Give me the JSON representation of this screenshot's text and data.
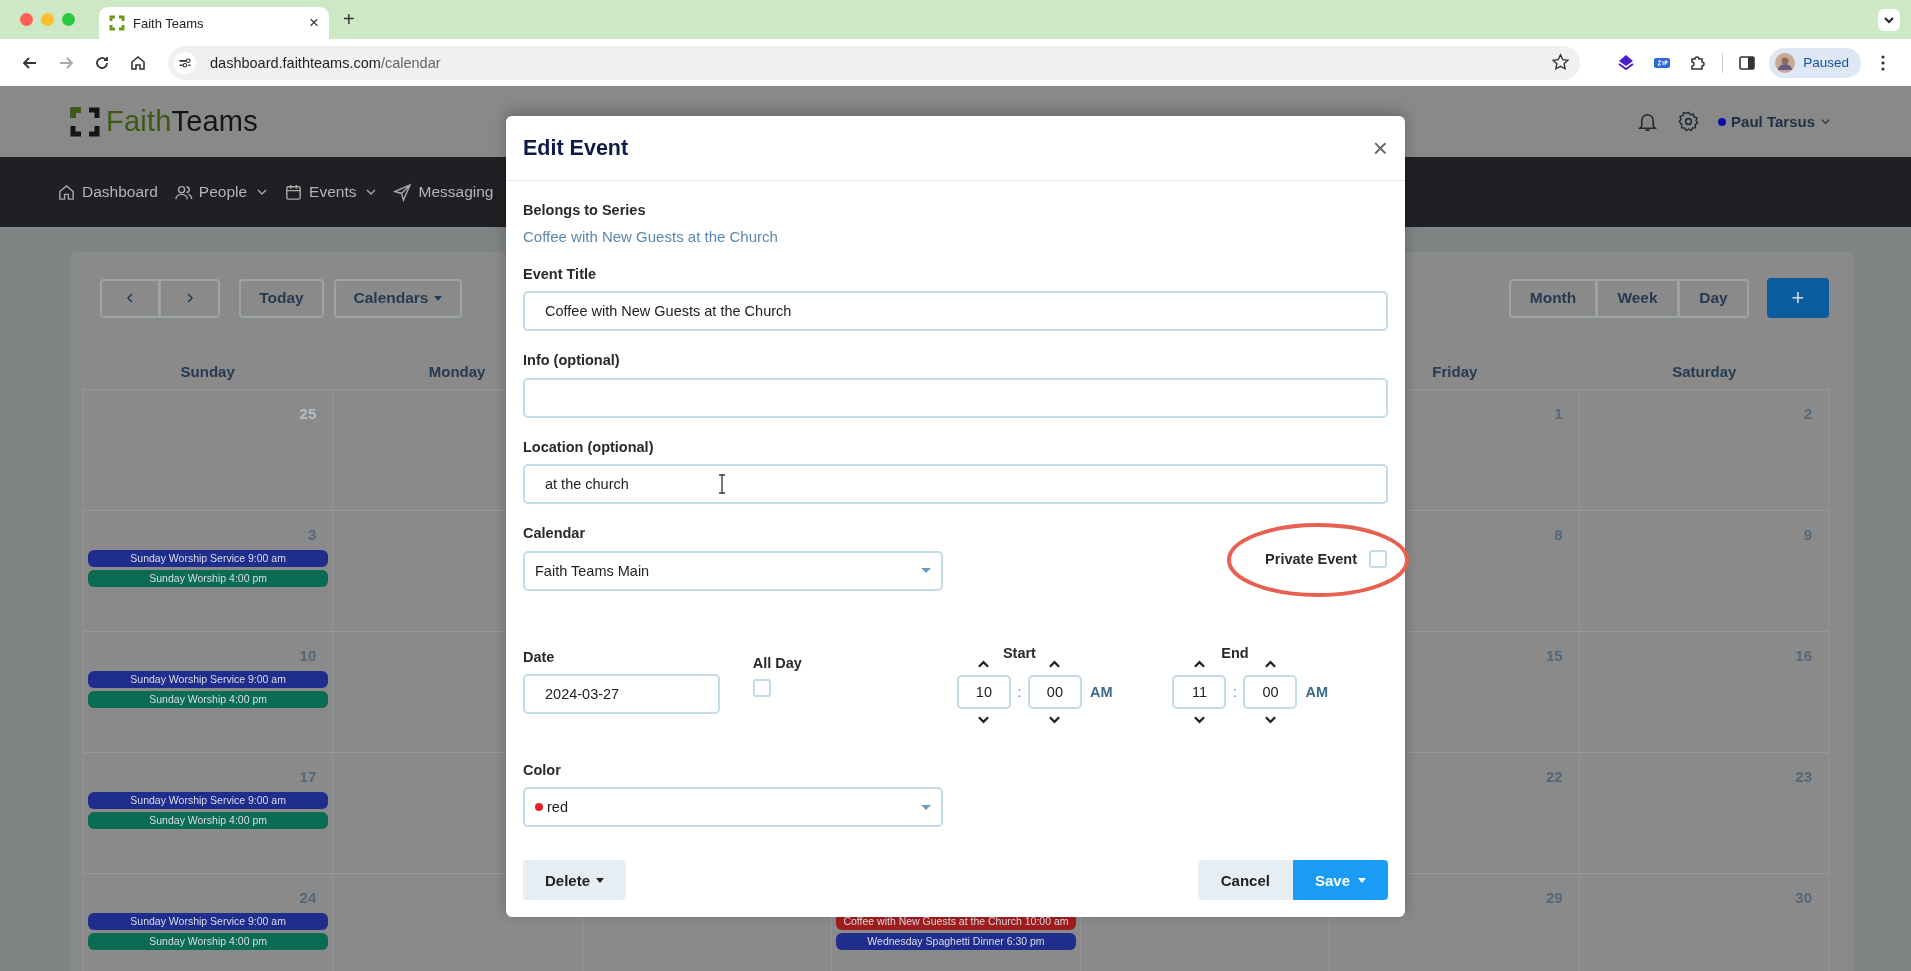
{
  "browser": {
    "tab": {
      "title": "Faith Teams",
      "close": "×"
    },
    "new_tab": "+",
    "address": {
      "host": "dashboard.faithteams.com",
      "path": "/calendar"
    },
    "profile": {
      "status": "Paused"
    }
  },
  "header": {
    "logo": {
      "first": "Faith",
      "second": "Teams"
    },
    "user": {
      "name": "Paul Tarsus",
      "color": "#0c0ca8"
    }
  },
  "nav": [
    {
      "label": "Dashboard",
      "kind": "home",
      "dropdown": false
    },
    {
      "label": "People",
      "kind": "people",
      "dropdown": true
    },
    {
      "label": "Events",
      "kind": "calendar",
      "dropdown": true
    },
    {
      "label": "Messaging",
      "kind": "send",
      "dropdown": false
    }
  ],
  "calendar": {
    "today": "Today",
    "calendars": "Calendars",
    "views": [
      "Month",
      "Week",
      "Day"
    ],
    "add": "+",
    "headers": {
      "sunday": "Sunday",
      "monday": "Monday",
      "friday": "Friday",
      "saturday": "Saturday"
    },
    "weeks": [
      {
        "sunday": {
          "day": "25",
          "muted": true
        },
        "friday": {
          "day": "1",
          "muted": false
        },
        "saturday": {
          "day": "2",
          "muted": false
        }
      },
      {
        "sunday": {
          "day": "3",
          "muted": false,
          "events": [
            {
              "text": "Sunday Worship Service 9:00 am",
              "color": "#1f2e8c"
            },
            {
              "text": "Sunday Worship 4:00 pm",
              "color": "#0b6b53"
            }
          ]
        },
        "friday": {
          "day": "8",
          "muted": false
        },
        "saturday": {
          "day": "9",
          "muted": false
        }
      },
      {
        "sunday": {
          "day": "10",
          "muted": false,
          "events": [
            {
              "text": "Sunday Worship Service 9:00 am",
              "color": "#1f2e8c"
            },
            {
              "text": "Sunday Worship 4:00 pm",
              "color": "#0b6b53"
            }
          ]
        },
        "friday": {
          "day": "15",
          "muted": false
        },
        "saturday": {
          "day": "16",
          "muted": false
        }
      },
      {
        "sunday": {
          "day": "17",
          "muted": false,
          "events": [
            {
              "text": "Sunday Worship Service 9:00 am",
              "color": "#1f2e8c"
            },
            {
              "text": "Sunday Worship 4:00 pm",
              "color": "#0b6b53"
            }
          ]
        },
        "friday": {
          "day": "22",
          "muted": false
        },
        "saturday": {
          "day": "23",
          "muted": false
        }
      },
      {
        "sunday": {
          "day": "24",
          "muted": false,
          "events": [
            {
              "text": "Sunday Worship Service 9:00 am",
              "color": "#1f2e8c"
            },
            {
              "text": "Sunday Worship 4:00 pm",
              "color": "#0b6b53"
            }
          ]
        },
        "wednesday": {
          "events": [
            {
              "text": "Coffee with New Guests at the Church 10:00 am",
              "color": "#a01d1d"
            },
            {
              "text": "Wednesday Spaghetti Dinner 6:30 pm",
              "color": "#1f2e8c"
            }
          ]
        },
        "friday": {
          "day": "29",
          "muted": false
        },
        "saturday": {
          "day": "30",
          "muted": false
        }
      }
    ]
  },
  "dialog": {
    "title": "Edit Event",
    "close": "×",
    "series": {
      "label": "Belongs to Series",
      "link": "Coffee with New Guests at the Church"
    },
    "fields": [
      {
        "label": "Event Title",
        "value": "Coffee with New Guests at the Church"
      },
      {
        "label": "Info (optional)"
      },
      {
        "label": "Location (optional)",
        "value": "at the church"
      }
    ],
    "calendar": {
      "label": "Calendar",
      "value": "Faith Teams Main"
    },
    "private": {
      "label": "Private Event",
      "checked": false
    },
    "date": {
      "label": "Date",
      "value": "2024-03-27"
    },
    "all_day": {
      "label": "All Day",
      "checked": false
    },
    "times": [
      {
        "label": "Start",
        "hour": "10",
        "separator": ":",
        "minute": "00",
        "period": "AM"
      },
      {
        "label": "End",
        "hour": "11",
        "separator": ":",
        "minute": "00",
        "period": "AM"
      }
    ],
    "color": {
      "label": "Color",
      "value": "red",
      "color": "#e8202a"
    },
    "buttons": {
      "delete": "Delete",
      "cancel": "Cancel",
      "save": "Save"
    }
  }
}
